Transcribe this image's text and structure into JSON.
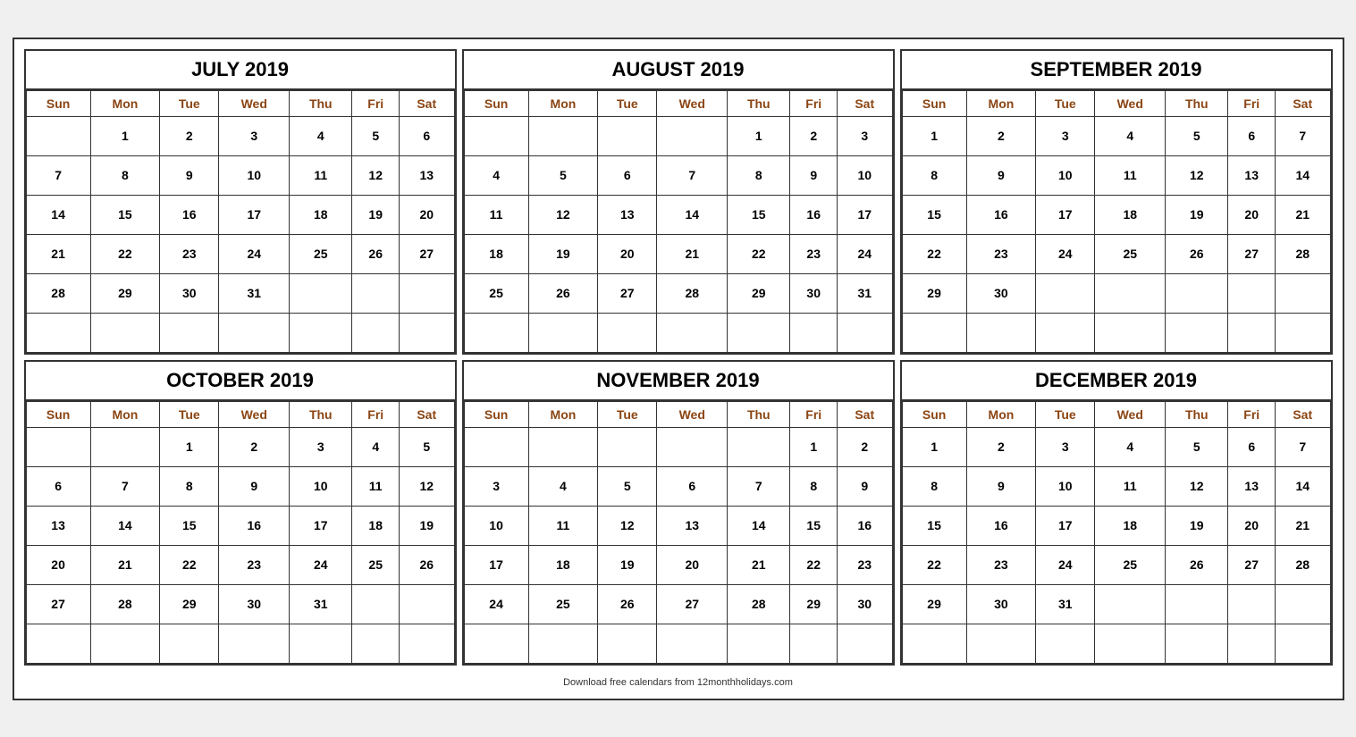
{
  "footer": "Download free calendars from 12monthholidays.com",
  "months": [
    {
      "id": "july-2019",
      "title": "JULY 2019",
      "days_header": [
        "Sun",
        "Mon",
        "Tue",
        "Wed",
        "Thu",
        "Fri",
        "Sat"
      ],
      "weeks": [
        [
          "",
          "1",
          "2",
          "3",
          "4",
          "5",
          "6"
        ],
        [
          "7",
          "8",
          "9",
          "10",
          "11",
          "12",
          "13"
        ],
        [
          "14",
          "15",
          "16",
          "17",
          "18",
          "19",
          "20"
        ],
        [
          "21",
          "22",
          "23",
          "24",
          "25",
          "26",
          "27"
        ],
        [
          "28",
          "29",
          "30",
          "31",
          "",
          "",
          ""
        ],
        [
          "",
          "",
          "",
          "",
          "",
          "",
          ""
        ]
      ]
    },
    {
      "id": "august-2019",
      "title": "AUGUST 2019",
      "days_header": [
        "Sun",
        "Mon",
        "Tue",
        "Wed",
        "Thu",
        "Fri",
        "Sat"
      ],
      "weeks": [
        [
          "",
          "",
          "",
          "",
          "1",
          "2",
          "3"
        ],
        [
          "4",
          "5",
          "6",
          "7",
          "8",
          "9",
          "10"
        ],
        [
          "11",
          "12",
          "13",
          "14",
          "15",
          "16",
          "17"
        ],
        [
          "18",
          "19",
          "20",
          "21",
          "22",
          "23",
          "24"
        ],
        [
          "25",
          "26",
          "27",
          "28",
          "29",
          "30",
          "31"
        ],
        [
          "",
          "",
          "",
          "",
          "",
          "",
          ""
        ]
      ]
    },
    {
      "id": "september-2019",
      "title": "SEPTEMBER 2019",
      "days_header": [
        "Sun",
        "Mon",
        "Tue",
        "Wed",
        "Thu",
        "Fri",
        "Sat"
      ],
      "weeks": [
        [
          "1",
          "2",
          "3",
          "4",
          "5",
          "6",
          "7"
        ],
        [
          "8",
          "9",
          "10",
          "11",
          "12",
          "13",
          "14"
        ],
        [
          "15",
          "16",
          "17",
          "18",
          "19",
          "20",
          "21"
        ],
        [
          "22",
          "23",
          "24",
          "25",
          "26",
          "27",
          "28"
        ],
        [
          "29",
          "30",
          "",
          "",
          "",
          "",
          ""
        ],
        [
          "",
          "",
          "",
          "",
          "",
          "",
          ""
        ]
      ]
    },
    {
      "id": "october-2019",
      "title": "OCTOBER 2019",
      "days_header": [
        "Sun",
        "Mon",
        "Tue",
        "Wed",
        "Thu",
        "Fri",
        "Sat"
      ],
      "weeks": [
        [
          "",
          "",
          "1",
          "2",
          "3",
          "4",
          "5"
        ],
        [
          "6",
          "7",
          "8",
          "9",
          "10",
          "11",
          "12"
        ],
        [
          "13",
          "14",
          "15",
          "16",
          "17",
          "18",
          "19"
        ],
        [
          "20",
          "21",
          "22",
          "23",
          "24",
          "25",
          "26"
        ],
        [
          "27",
          "28",
          "29",
          "30",
          "31",
          "",
          ""
        ],
        [
          "",
          "",
          "",
          "",
          "",
          "",
          ""
        ]
      ]
    },
    {
      "id": "november-2019",
      "title": "NOVEMBER 2019",
      "days_header": [
        "Sun",
        "Mon",
        "Tue",
        "Wed",
        "Thu",
        "Fri",
        "Sat"
      ],
      "weeks": [
        [
          "",
          "",
          "",
          "",
          "",
          "1",
          "2"
        ],
        [
          "3",
          "4",
          "5",
          "6",
          "7",
          "8",
          "9"
        ],
        [
          "10",
          "11",
          "12",
          "13",
          "14",
          "15",
          "16"
        ],
        [
          "17",
          "18",
          "19",
          "20",
          "21",
          "22",
          "23"
        ],
        [
          "24",
          "25",
          "26",
          "27",
          "28",
          "29",
          "30"
        ],
        [
          "",
          "",
          "",
          "",
          "",
          "",
          ""
        ]
      ]
    },
    {
      "id": "december-2019",
      "title": "DECEMBER 2019",
      "days_header": [
        "Sun",
        "Mon",
        "Tue",
        "Wed",
        "Thu",
        "Fri",
        "Sat"
      ],
      "weeks": [
        [
          "1",
          "2",
          "3",
          "4",
          "5",
          "6",
          "7"
        ],
        [
          "8",
          "9",
          "10",
          "11",
          "12",
          "13",
          "14"
        ],
        [
          "15",
          "16",
          "17",
          "18",
          "19",
          "20",
          "21"
        ],
        [
          "22",
          "23",
          "24",
          "25",
          "26",
          "27",
          "28"
        ],
        [
          "29",
          "30",
          "31",
          "",
          "",
          "",
          ""
        ],
        [
          "",
          "",
          "",
          "",
          "",
          "",
          ""
        ]
      ]
    }
  ]
}
